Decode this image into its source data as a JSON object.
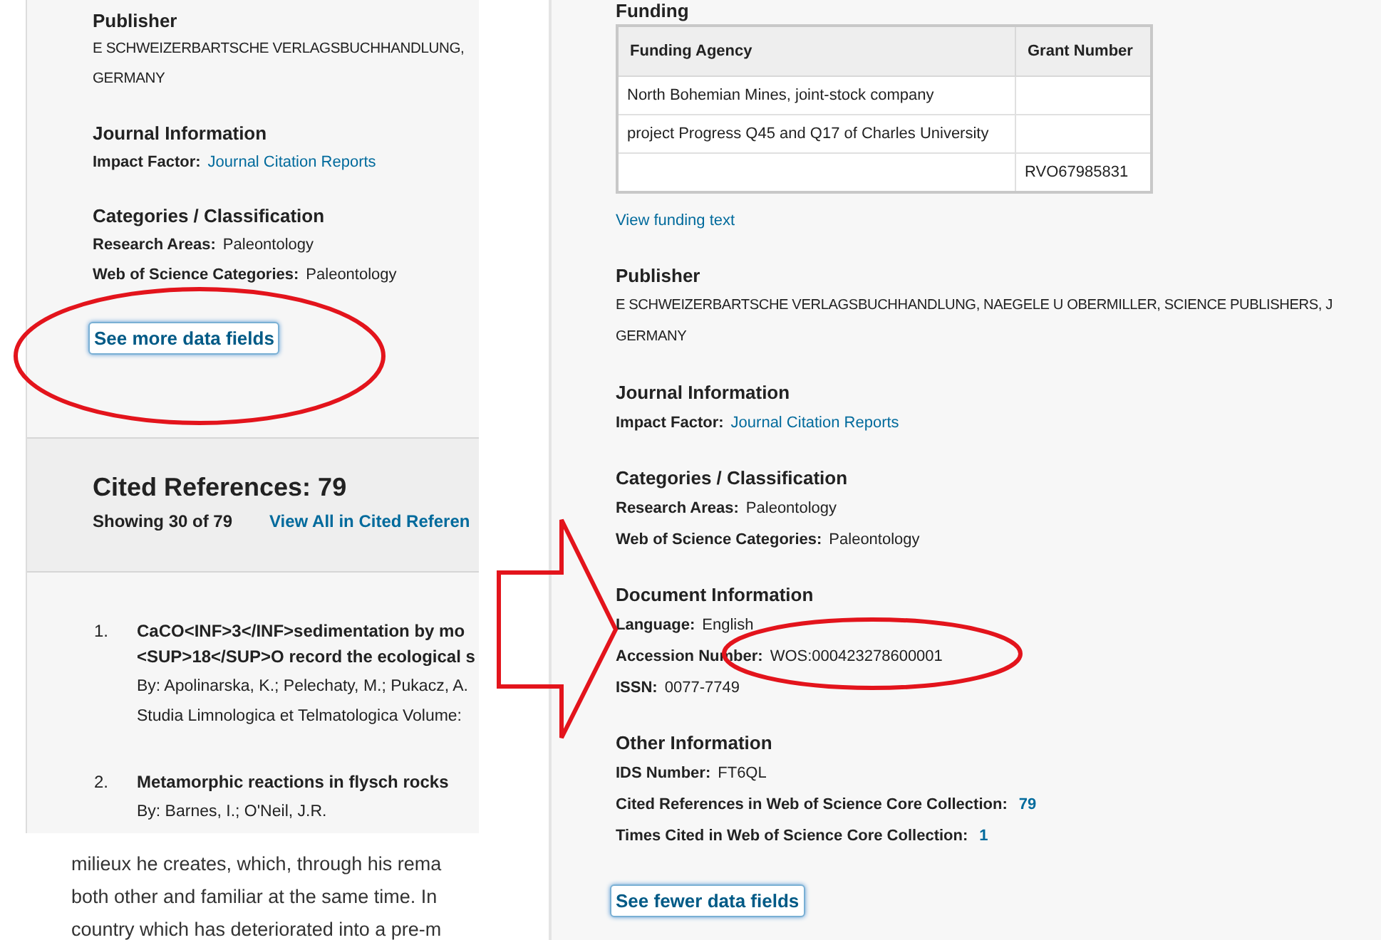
{
  "left_panel": {
    "publisher": {
      "heading": "Publisher",
      "lines": [
        "E SCHWEIZERBARTSCHE VERLAGSBUCHHANDLUNG,",
        "GERMANY"
      ]
    },
    "journal_information": {
      "heading": "Journal Information",
      "fields": [
        {
          "label": "Impact Factor:",
          "value": "Journal Citation Reports",
          "kind": "link"
        }
      ]
    },
    "categories": {
      "heading": "Categories / Classification",
      "fields": [
        {
          "label": "Research Areas:",
          "value": "Paleontology",
          "kind": "text"
        },
        {
          "label": "Web of Science Categories:",
          "value": "Paleontology",
          "kind": "text"
        }
      ]
    },
    "more_button": "See more data fields",
    "cited_references": {
      "title": "Cited References: 79",
      "showing": "Showing 30 of 79",
      "view_all": "View All in Cited Referen"
    },
    "references": [
      {
        "number": "1.",
        "title_lines": [
          "CaCO<INF>3</INF>sedimentation by mo",
          "<SUP>18</SUP>O record the ecological s"
        ],
        "authors": "By: Apolinarska, K.; Pelechaty, M.; Pukacz, A.",
        "source": "Studia Limnologica et Telmatologica  Volume:"
      },
      {
        "number": "2.",
        "title_lines": [
          "Metamorphic reactions in flysch rocks"
        ],
        "authors": "By: Barnes, I.; O'Neil, J.R."
      }
    ]
  },
  "article_excerpt": {
    "lines": [
      "milieux he creates, which, through his rema",
      "both other and familiar at the same time. In",
      "country which has deteriorated into a pre-m"
    ]
  },
  "right_panel": {
    "funding": {
      "heading": "Funding",
      "columns": [
        "Funding Agency",
        "Grant Number"
      ],
      "rows": [
        [
          "North Bohemian Mines, joint-stock company",
          ""
        ],
        [
          "project Progress Q45 and Q17 of Charles University",
          ""
        ],
        [
          "",
          "RVO67985831"
        ]
      ],
      "link": "View funding text"
    },
    "sections": [
      {
        "heading": "Publisher",
        "lines": [
          "E SCHWEIZERBARTSCHE VERLAGSBUCHHANDLUNG, NAEGELE U OBERMILLER, SCIENCE PUBLISHERS, J",
          "GERMANY"
        ]
      },
      {
        "heading": "Journal Information",
        "fields": [
          {
            "label": "Impact Factor:",
            "value": "Journal Citation Reports",
            "kind": "link"
          }
        ]
      },
      {
        "heading": "Categories / Classification",
        "fields": [
          {
            "label": "Research Areas:",
            "value": "Paleontology",
            "kind": "text"
          },
          {
            "label": "Web of Science Categories:",
            "value": "Paleontology",
            "kind": "text"
          }
        ]
      },
      {
        "heading": "Document Information",
        "fields": [
          {
            "label": "Language:",
            "value": "English",
            "kind": "text"
          },
          {
            "label": "Accession Number:",
            "value": "WOS:000423278600001",
            "kind": "text"
          },
          {
            "label": "ISSN:",
            "value": "0077-7749",
            "kind": "text"
          }
        ]
      },
      {
        "heading": "Other Information",
        "fields": [
          {
            "label": "IDS Number:",
            "value": "FT6QL",
            "kind": "text"
          },
          {
            "label": "Cited References in Web of Science Core Collection:",
            "value": "79",
            "kind": "count"
          },
          {
            "label": "Times Cited in Web of Science Core Collection:",
            "value": "1",
            "kind": "count"
          }
        ]
      }
    ],
    "fewer_button": "See fewer data fields"
  }
}
